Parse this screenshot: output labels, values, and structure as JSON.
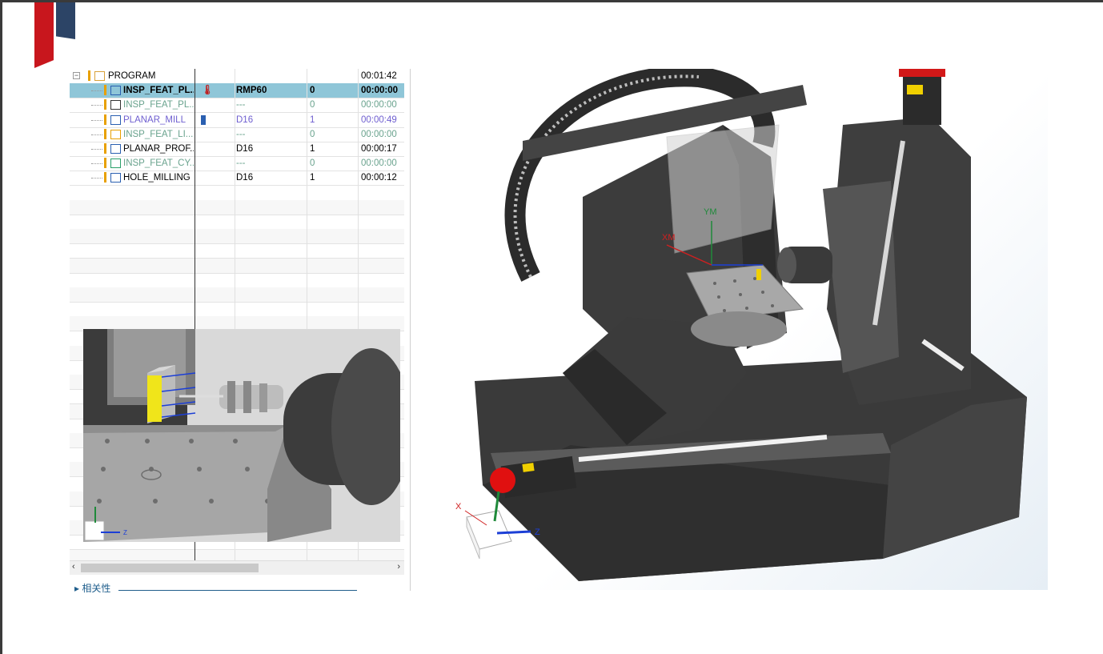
{
  "header": {
    "brand_colors": {
      "red": "#c8161d",
      "navy": "#2c4466"
    }
  },
  "navigator": {
    "rows": [
      {
        "name": "PROGRAM",
        "tool": "",
        "num": "",
        "time": "00:01:42",
        "icon": "program-folder-icon",
        "style": "normal",
        "level": 0
      },
      {
        "name": "INSP_FEAT_PL...",
        "tool": "RMP60",
        "num": "0",
        "time": "00:00:00",
        "icon": "probe-operation-icon",
        "style": "selected",
        "level": 1
      },
      {
        "name": "INSP_FEAT_PL...",
        "tool": "---",
        "num": "0",
        "time": "00:00:00",
        "icon": "plane-feature-icon",
        "style": "gray",
        "level": 1
      },
      {
        "name": "PLANAR_MILL",
        "tool": "D16",
        "num": "1",
        "time": "00:00:49",
        "icon": "planar-mill-icon",
        "style": "purple",
        "level": 1
      },
      {
        "name": "INSP_FEAT_LI...",
        "tool": "---",
        "num": "0",
        "time": "00:00:00",
        "icon": "line-feature-icon",
        "style": "gray",
        "level": 1
      },
      {
        "name": "PLANAR_PROF...",
        "tool": "D16",
        "num": "1",
        "time": "00:00:17",
        "icon": "planar-profile-icon",
        "style": "normal",
        "level": 1
      },
      {
        "name": "INSP_FEAT_CY...",
        "tool": "---",
        "num": "0",
        "time": "00:00:00",
        "icon": "cylinder-feature-icon",
        "style": "gray",
        "level": 1
      },
      {
        "name": "HOLE_MILLING",
        "tool": "D16",
        "num": "1",
        "time": "00:00:12",
        "icon": "hole-milling-icon",
        "style": "normal",
        "level": 1
      }
    ],
    "related_label": "相关性"
  },
  "inset_view": {
    "axes": [
      "Z"
    ]
  },
  "viewport": {
    "workpiece_axes": {
      "x": "XM",
      "y": "YM"
    },
    "triad_axes": {
      "x": "X",
      "z": "Z"
    }
  }
}
